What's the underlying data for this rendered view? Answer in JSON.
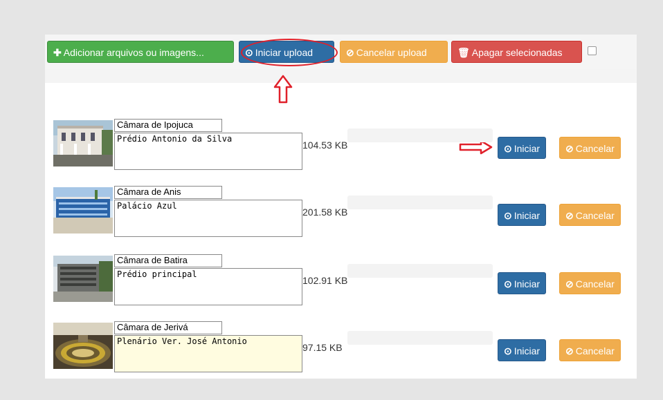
{
  "toolbar": {
    "add_label": "Adicionar arquivos ou imagens...",
    "start_label": "Iniciar upload",
    "cancel_label": "Cancelar upload",
    "delete_label": "Apagar selecionadas",
    "select_all_checked": false
  },
  "files": [
    {
      "name": "Câmara de Ipojuca",
      "description": "Prédio Antonio da Silva",
      "size": "104.53 KB",
      "start_label": "Iniciar",
      "cancel_label": "Cancelar"
    },
    {
      "name": "Câmara de Anis",
      "description": "Palácio Azul",
      "size": "201.58 KB",
      "start_label": "Iniciar",
      "cancel_label": "Cancelar"
    },
    {
      "name": "Câmara de Batira",
      "description": "Prédio principal",
      "size": "102.91 KB",
      "start_label": "Iniciar",
      "cancel_label": "Cancelar"
    },
    {
      "name": "Câmara de Jerivá",
      "description": "Plenário Ver. José Antonio",
      "size": "97.15 KB",
      "start_label": "Iniciar",
      "cancel_label": "Cancelar"
    }
  ],
  "icons": {
    "add": "plus-icon",
    "start": "arrow-circle-up-icon",
    "cancel": "ban-icon",
    "delete": "trash-icon"
  },
  "colors": {
    "green": "#4cae4c",
    "blue": "#2e6da4",
    "orange": "#f0ad4e",
    "red": "#d9534f",
    "annotation": "#e0202a"
  }
}
